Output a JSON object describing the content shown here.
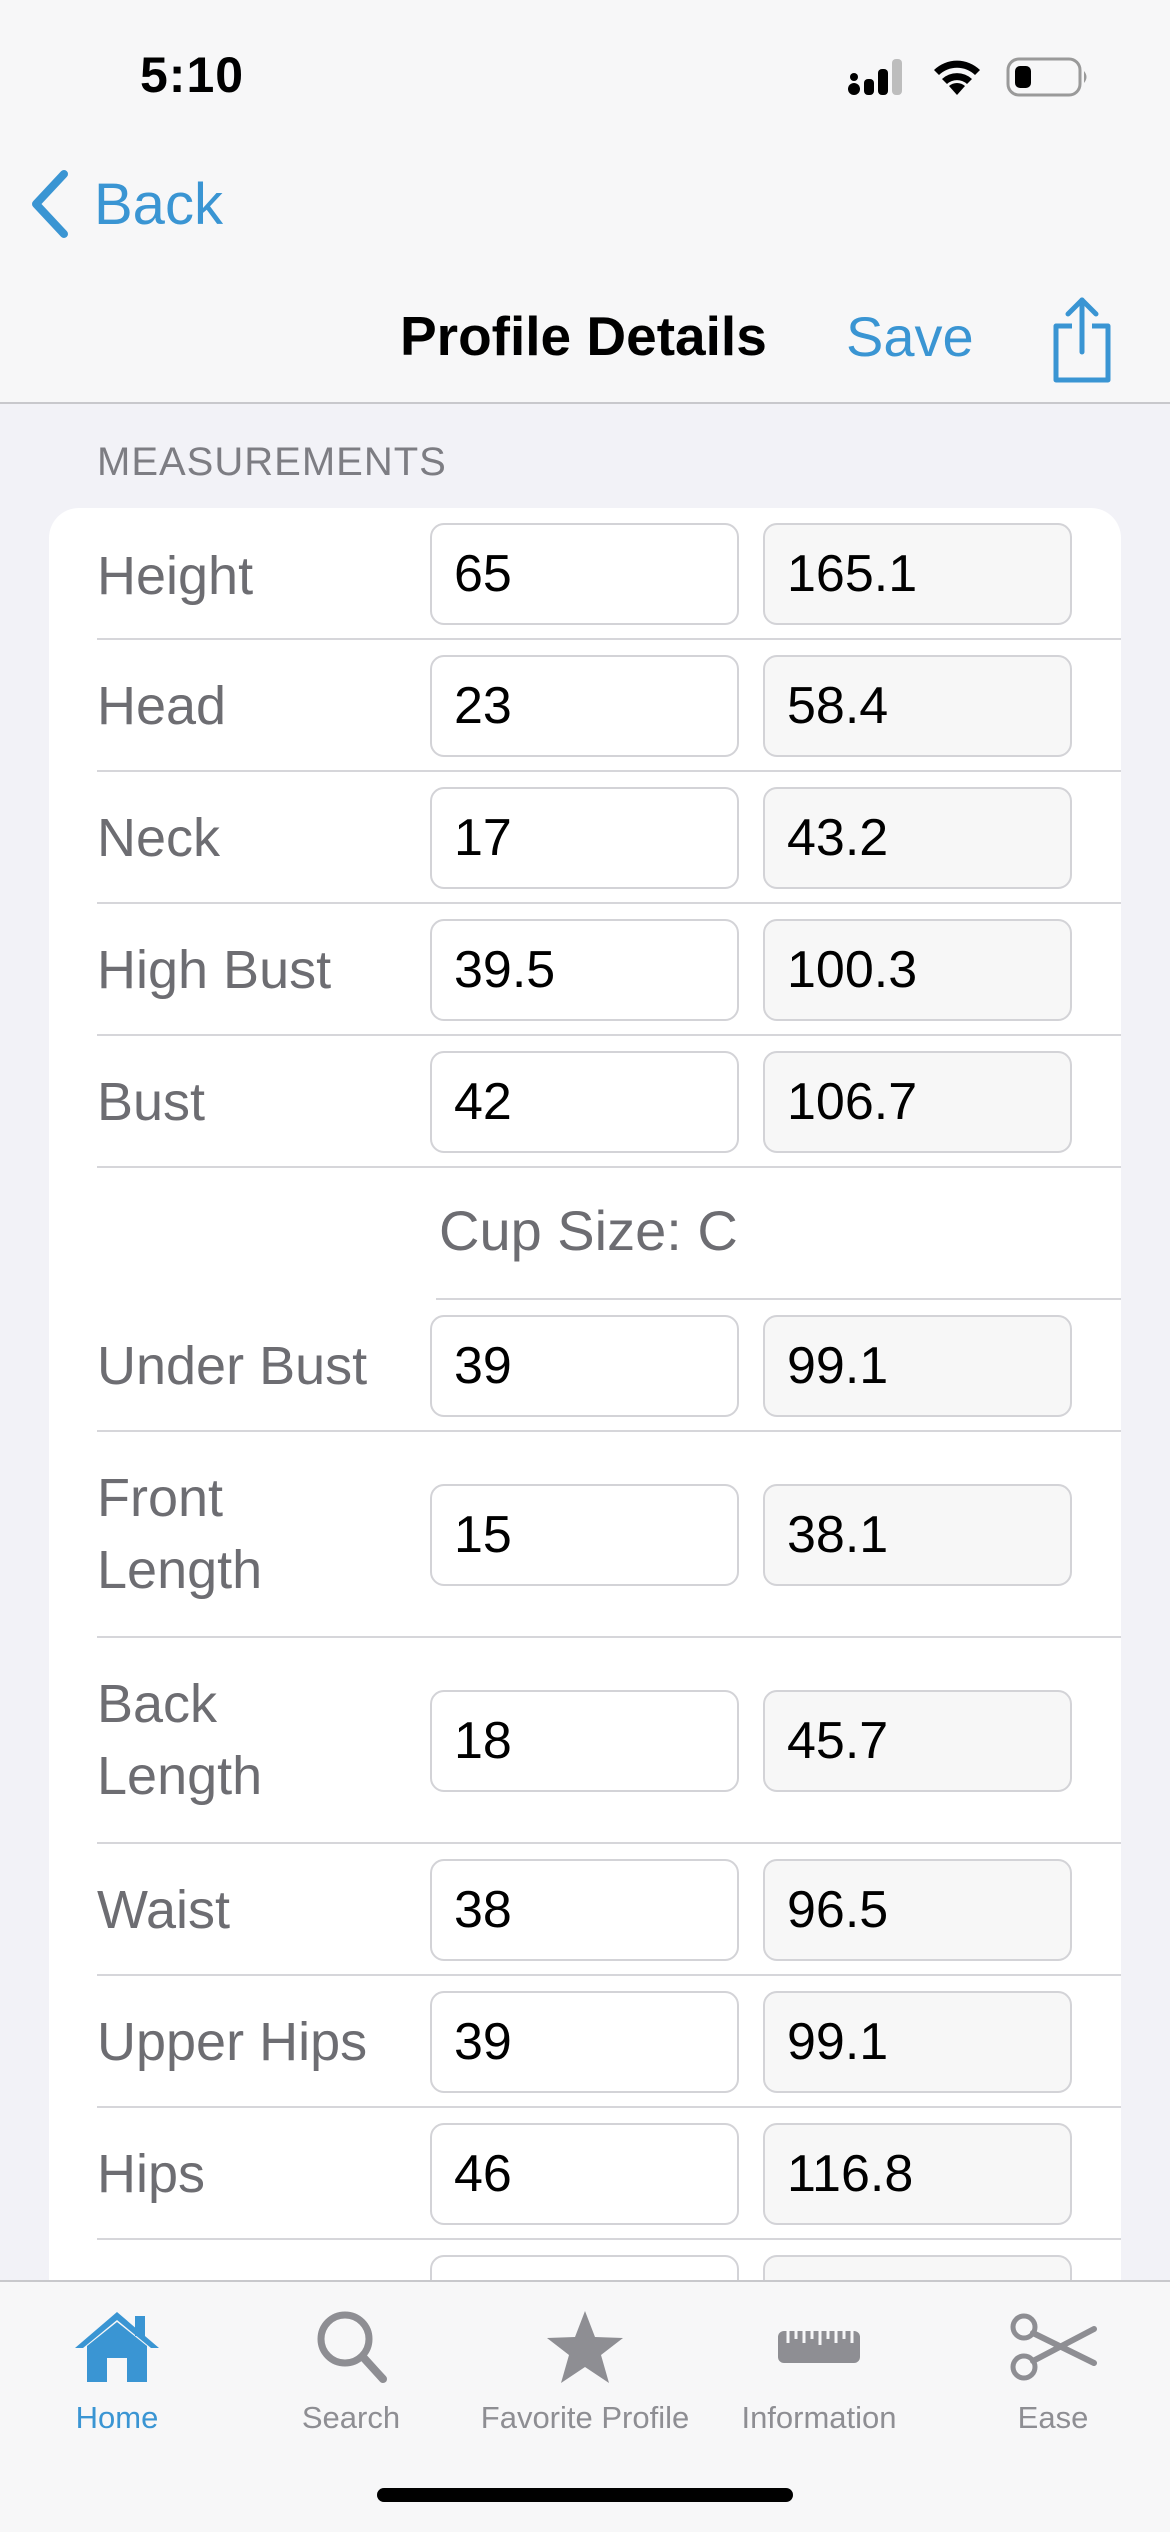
{
  "status_bar": {
    "time": "5:10"
  },
  "nav": {
    "back_label": "Back",
    "title": "Profile Details",
    "save_label": "Save"
  },
  "section": {
    "header": "MEASUREMENTS"
  },
  "measurements": [
    {
      "label": "Height",
      "inches": "65",
      "cm": "165.1"
    },
    {
      "label": "Head",
      "inches": "23",
      "cm": "58.4"
    },
    {
      "label": "Neck",
      "inches": "17",
      "cm": "43.2"
    },
    {
      "label": "High Bust",
      "inches": "39.5",
      "cm": "100.3"
    },
    {
      "label": "Bust",
      "inches": "42",
      "cm": "106.7"
    },
    {
      "label": "Under Bust",
      "inches": "39",
      "cm": "99.1"
    },
    {
      "label": "Front Length",
      "inches": "15",
      "cm": "38.1"
    },
    {
      "label": "Back Length",
      "inches": "18",
      "cm": "45.7"
    },
    {
      "label": "Waist",
      "inches": "38",
      "cm": "96.5"
    },
    {
      "label": "Upper Hips",
      "inches": "39",
      "cm": "99.1"
    },
    {
      "label": "Hips",
      "inches": "46",
      "cm": "116.8"
    }
  ],
  "cup_size": "Cup Size: C",
  "tabbar": {
    "items": [
      {
        "label": "Home",
        "icon": "house-icon",
        "active": true
      },
      {
        "label": "Search",
        "icon": "magnifier-icon",
        "active": false
      },
      {
        "label": "Favorite Profile",
        "icon": "star-icon",
        "active": false
      },
      {
        "label": "Information",
        "icon": "ruler-icon",
        "active": false
      },
      {
        "label": "Ease",
        "icon": "scissors-icon",
        "active": false
      }
    ]
  },
  "colors": {
    "accent": "#3a95d3",
    "background": "#f2f2f7",
    "card": "#ffffff"
  }
}
